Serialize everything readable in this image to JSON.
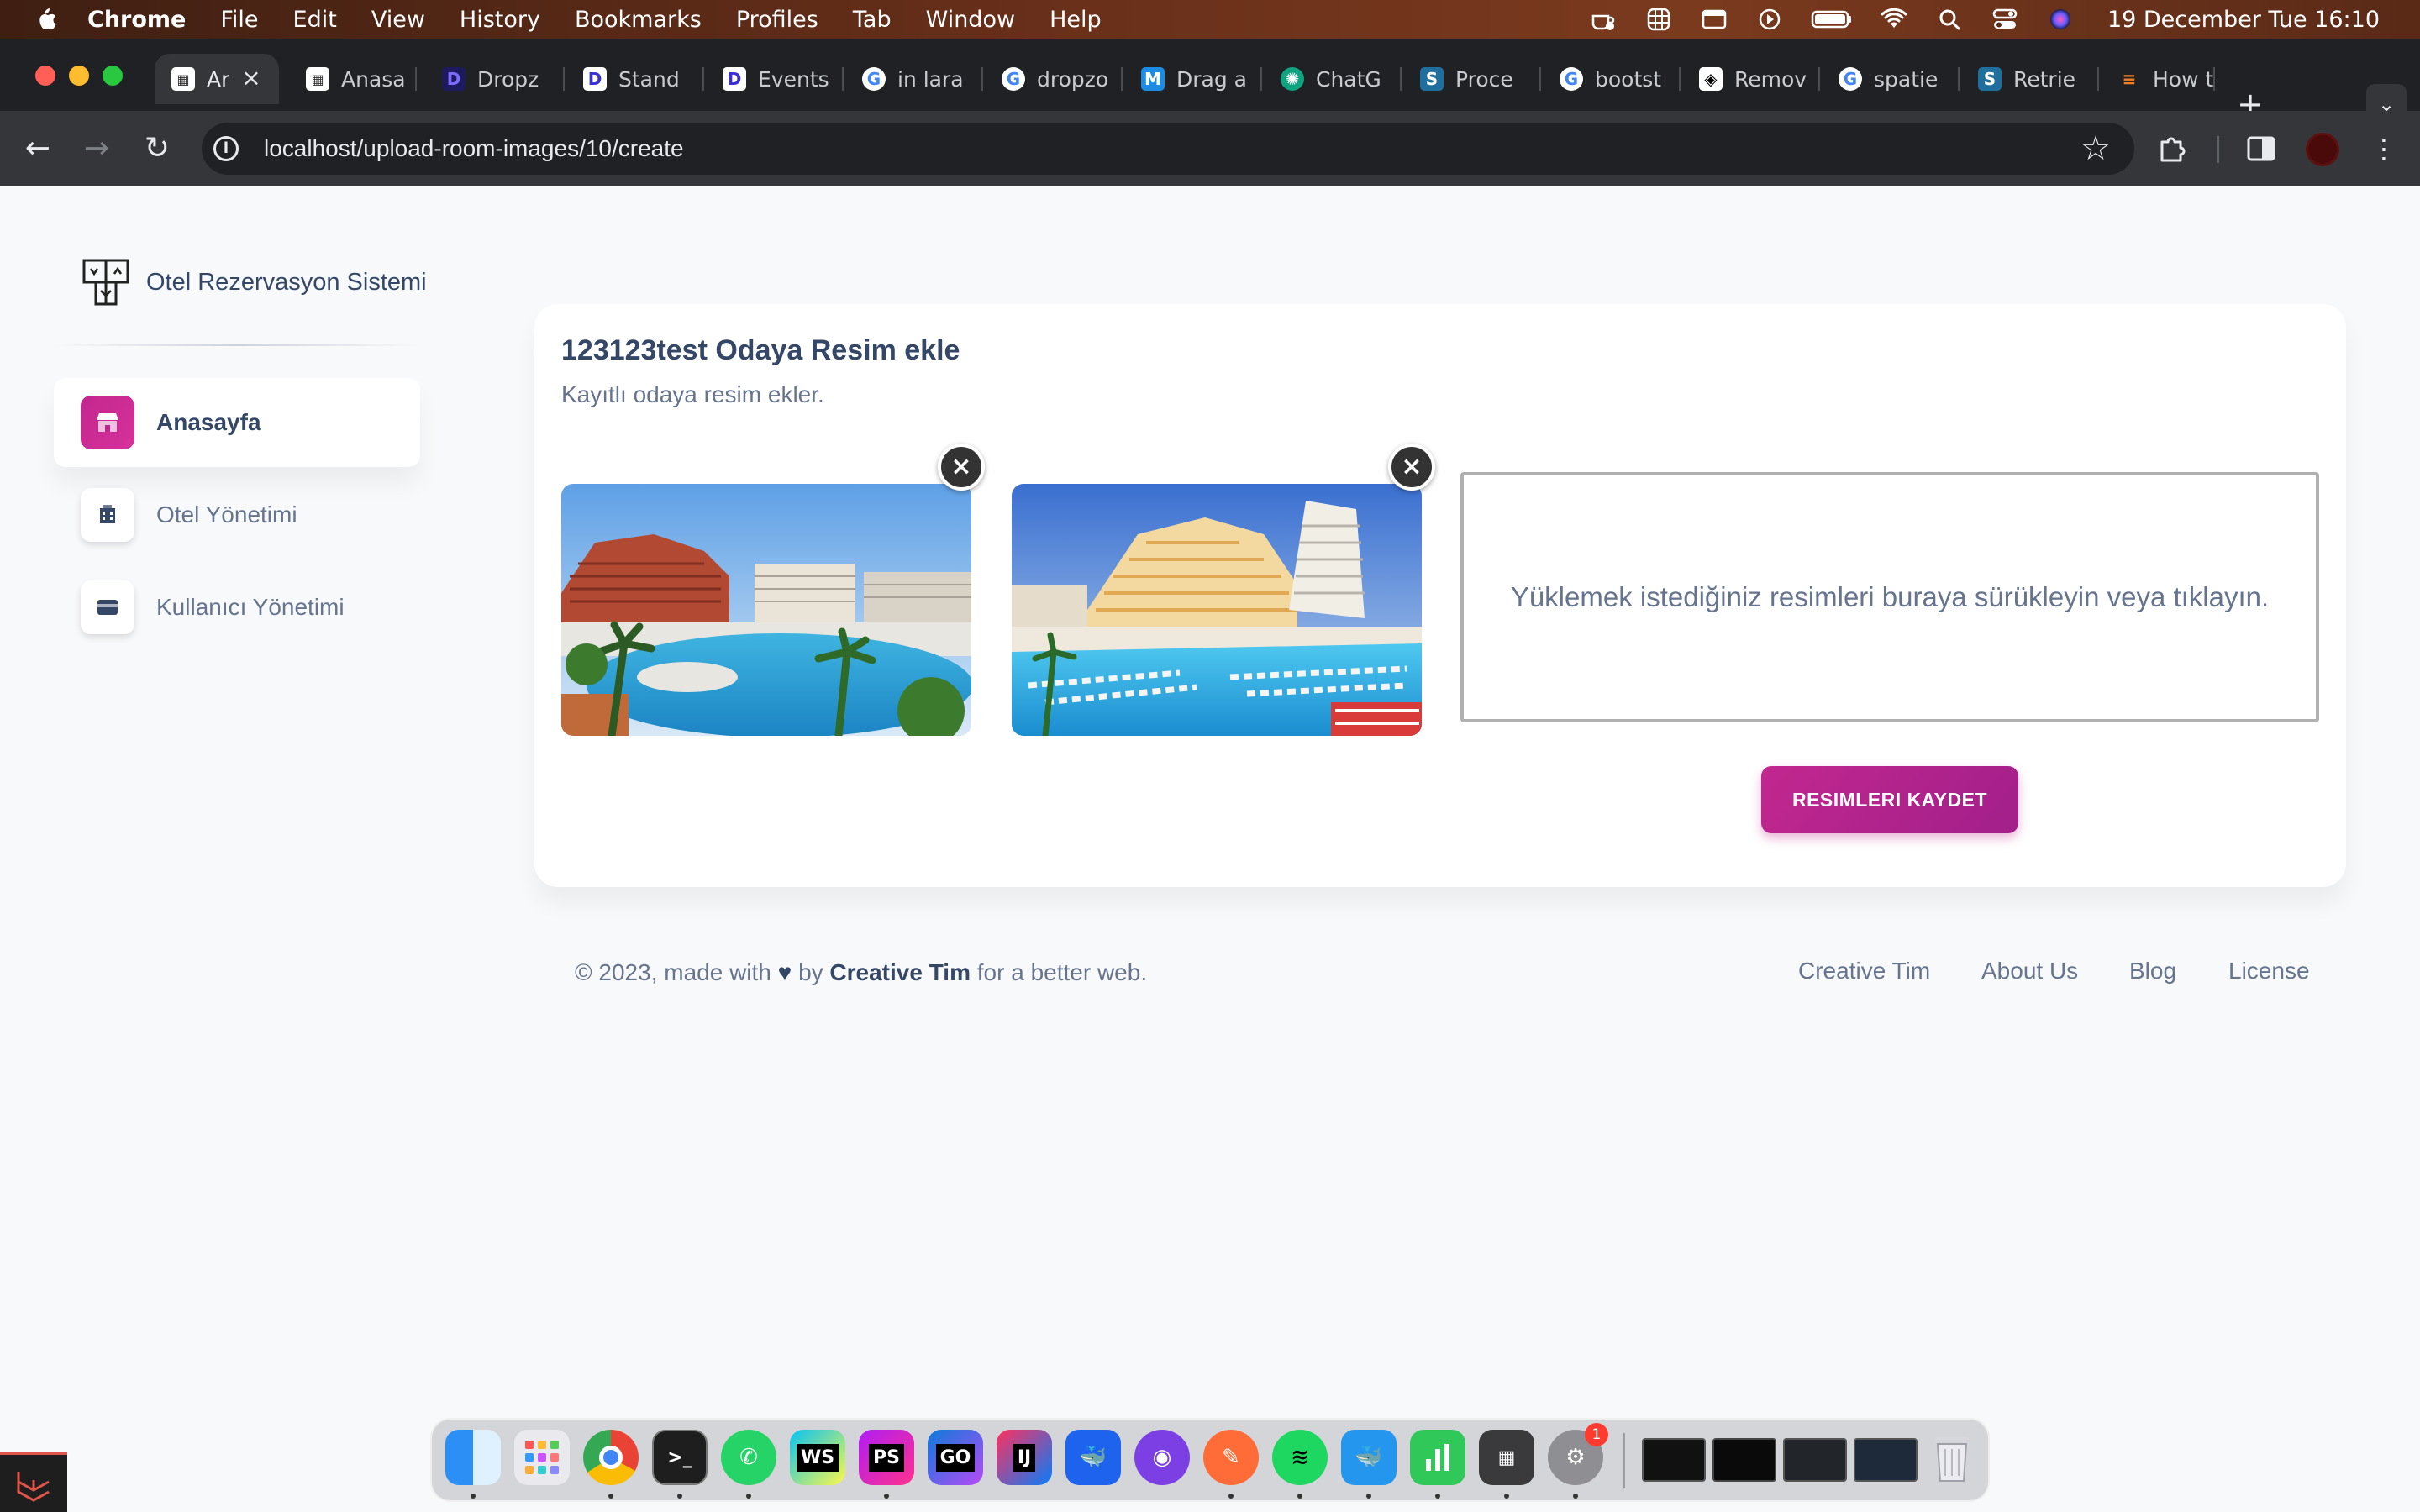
{
  "menubar": {
    "items": [
      "Chrome",
      "File",
      "Edit",
      "View",
      "History",
      "Bookmarks",
      "Profiles",
      "Tab",
      "Window",
      "Help"
    ],
    "clock": "19 December Tue  16:10"
  },
  "tabs": [
    {
      "title": "Ar",
      "fav": "grid"
    },
    {
      "title": "Anasa",
      "fav": "grid"
    },
    {
      "title": "Dropz",
      "fav": "dropzone"
    },
    {
      "title": "Stand",
      "fav": "dropzone"
    },
    {
      "title": "Events",
      "fav": "dropzone"
    },
    {
      "title": "in lara",
      "fav": "google"
    },
    {
      "title": "dropzo",
      "fav": "google"
    },
    {
      "title": "Drag a",
      "fav": "medium"
    },
    {
      "title": "ChatG",
      "fav": "chatgpt"
    },
    {
      "title": "Proce",
      "fav": "stack"
    },
    {
      "title": "bootst",
      "fav": "google"
    },
    {
      "title": "Remov",
      "fav": "codepen"
    },
    {
      "title": "spatie",
      "fav": "google"
    },
    {
      "title": "Retrie",
      "fav": "stack"
    },
    {
      "title": "How t",
      "fav": "so"
    }
  ],
  "browser": {
    "url_host": "localhost",
    "url_path": "/upload-room-images/10/create"
  },
  "sidebar": {
    "brand": "Otel Rezervasyon Sistemi",
    "items": [
      {
        "label": "Anasayfa",
        "icon": "shop-icon",
        "active": true
      },
      {
        "label": "Otel Yönetimi",
        "icon": "office-icon",
        "active": false
      },
      {
        "label": "Kullanıcı Yönetimi",
        "icon": "credit-card-icon",
        "active": false
      }
    ]
  },
  "card": {
    "title": "123123test Odaya Resim ekle",
    "subtitle": "Kayıtlı odaya resim ekler.",
    "dropzone_text": "Yüklemek istediğiniz resimleri buraya sürükleyin veya tıklayın.",
    "save_button": "RESIMLERI KAYDET",
    "remove_symbol": "×"
  },
  "footer": {
    "prefix": "© 2023, made with",
    "by": "by",
    "author": "Creative Tim",
    "suffix": "for a better web.",
    "links": [
      "Creative Tim",
      "About Us",
      "Blog",
      "License"
    ]
  },
  "dock": {
    "apps": [
      "Finder",
      "Launchpad",
      "Chrome",
      "Terminal",
      "WhatsApp",
      "WebStorm",
      "PhpStorm",
      "GoLand",
      "IntelliJ IDEA",
      "Docker",
      "GitHub Desktop",
      "Postman",
      "Spotify",
      "Docker Desktop",
      "Numbers",
      "Calculator",
      "System Settings"
    ],
    "settings_badge": "1"
  },
  "colors": {
    "accent": "#c2278f",
    "text_dark": "#344767",
    "text_muted": "#67748e",
    "page_bg": "#f8f9fa"
  }
}
